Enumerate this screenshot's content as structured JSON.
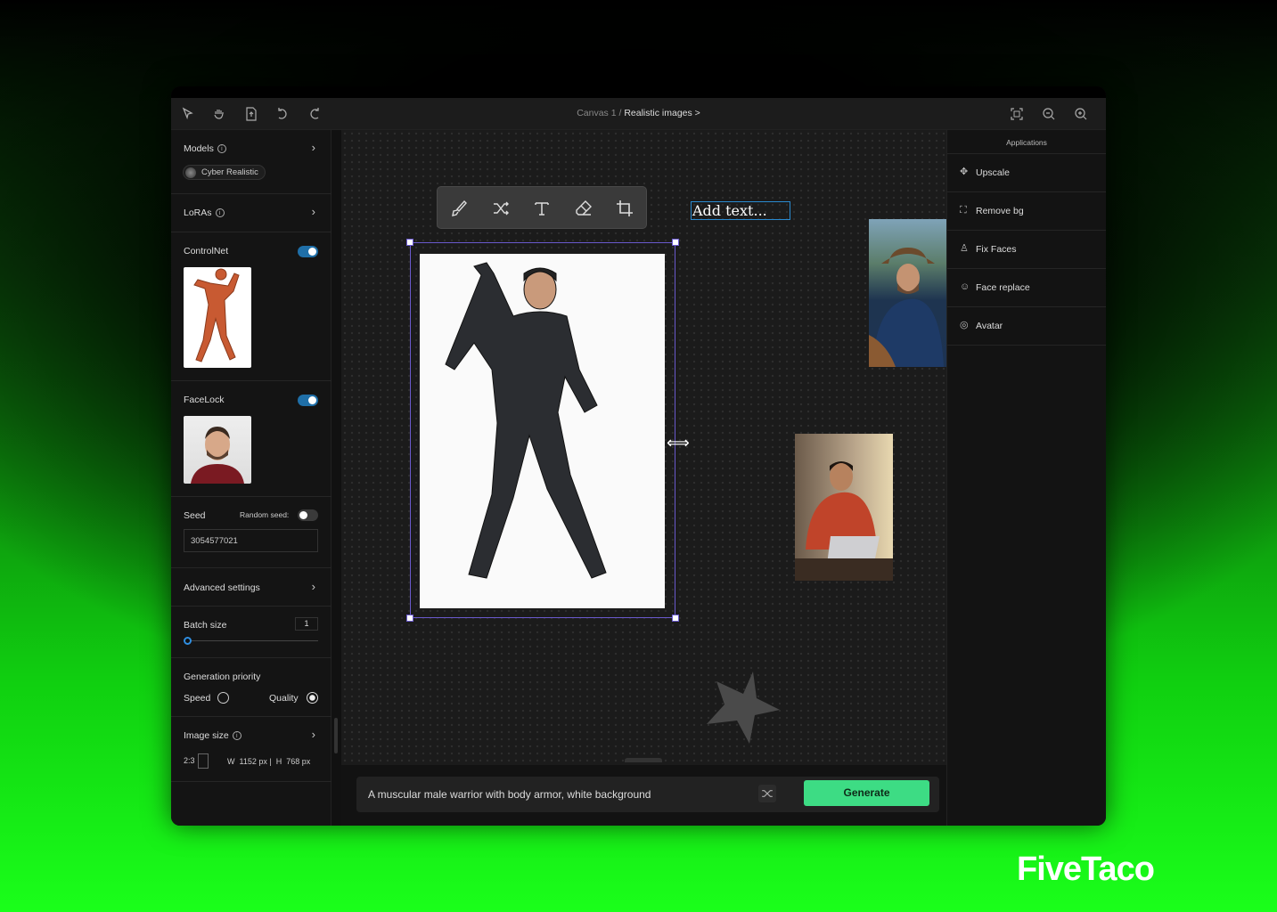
{
  "toolbar": {
    "breadcrumb_prefix": "Canvas 1 /",
    "breadcrumb_current": "Realistic images >",
    "icons": [
      "select-cursor-icon",
      "hand-icon",
      "export-icon",
      "undo-icon",
      "redo-icon",
      "fit-screen-icon",
      "zoom-out-icon",
      "zoom-in-icon"
    ]
  },
  "left": {
    "models": {
      "label": "Models",
      "selected": "Cyber Realistic"
    },
    "loras": {
      "label": "LoRAs"
    },
    "controlnet": {
      "label": "ControlNet",
      "enabled": true
    },
    "facelock": {
      "label": "FaceLock",
      "enabled": true
    },
    "seed": {
      "label": "Seed",
      "random_label": "Random seed:",
      "random_enabled": false,
      "value": "3054577021"
    },
    "advanced": {
      "label": "Advanced settings"
    },
    "batch": {
      "label": "Batch size",
      "value": "1",
      "slider_fraction": 0
    },
    "priority": {
      "label": "Generation priority",
      "speed": "Speed",
      "quality": "Quality",
      "selected": "Quality"
    },
    "image_size": {
      "label": "Image size",
      "ratio": "2:3",
      "w_label": "W",
      "w": "1152 px",
      "h_label": "H",
      "h": "768 px"
    }
  },
  "canvas": {
    "tools": [
      "brush-icon",
      "shuffle-icon",
      "text-icon",
      "eraser-icon",
      "crop-icon"
    ],
    "add_text": "Add text..."
  },
  "prompt": {
    "value": "A muscular male warrior with body armor, white background",
    "generate": "Generate",
    "accent": "#3ddc84"
  },
  "right": {
    "title": "Applications",
    "items": [
      {
        "label": "Upscale",
        "icon": "move-arrows-icon"
      },
      {
        "label": "Remove bg",
        "icon": "person-frame-icon"
      },
      {
        "label": "Fix Faces",
        "icon": "face-fix-icon"
      },
      {
        "label": "Face replace",
        "icon": "smiley-icon"
      },
      {
        "label": "Avatar",
        "icon": "avatar-icon"
      }
    ]
  },
  "brand": {
    "logo": "FiveTaco"
  }
}
